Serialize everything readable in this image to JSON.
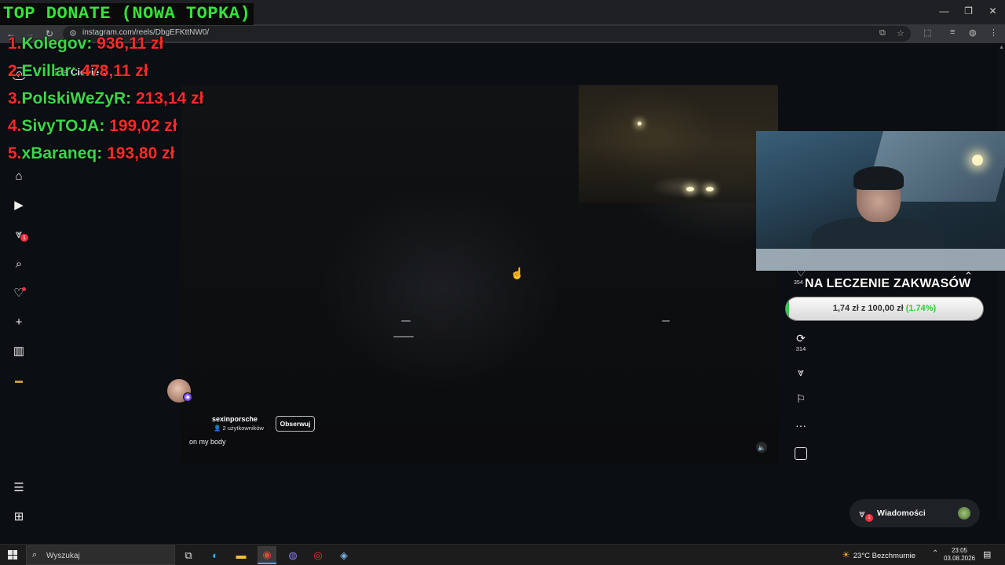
{
  "browser": {
    "url": "instagram.com/reels/DbgEFKttNW0/",
    "window_controls": [
      "—",
      "❐",
      "✕"
    ]
  },
  "instagram": {
    "feed_selector": "Dla Ciebie",
    "sidebar_notification_badge": "1",
    "reel": {
      "username": "sexinporsche",
      "collab_label": "2 użytkowników",
      "follow_label": "Obserwuj",
      "caption": "on my body"
    },
    "actions": {
      "like_count": "354",
      "repost_count": "314"
    },
    "messages": {
      "label": "Wiadomości",
      "badge": "1"
    }
  },
  "overlay": {
    "donate_title": "TOP DONATE (NOWA TOPKA)",
    "donors": [
      {
        "rank": "1.",
        "name": "Kolegov:",
        "amount": "936,11 zł"
      },
      {
        "rank": "2.",
        "name": "Evillar:",
        "amount": "478,11 zł"
      },
      {
        "rank": "3.",
        "name": "PolskiWeZyR:",
        "amount": "213,14 zł"
      },
      {
        "rank": "4.",
        "name": "SivyTOJA:",
        "amount": "199,02 zł"
      },
      {
        "rank": "5.",
        "name": "xBaraneq:",
        "amount": "193,80 zł"
      }
    ],
    "goal": {
      "title": "NA LECZENIE ZAKWASÓW",
      "progress_text": "1,74 zł z 100,00 zł",
      "percent_text": "(1.74%)",
      "fraction": 0.0174
    }
  },
  "taskbar": {
    "search_placeholder": "Wyszukaj",
    "weather": "23°C  Bezchmurnie",
    "time": "23:05",
    "date": "03.08.2026"
  },
  "colors": {
    "donor_name": "#3bd64a",
    "donor_amount": "#ff2b2b",
    "goal_fill": "#34c759",
    "notification": "#ff3040"
  }
}
